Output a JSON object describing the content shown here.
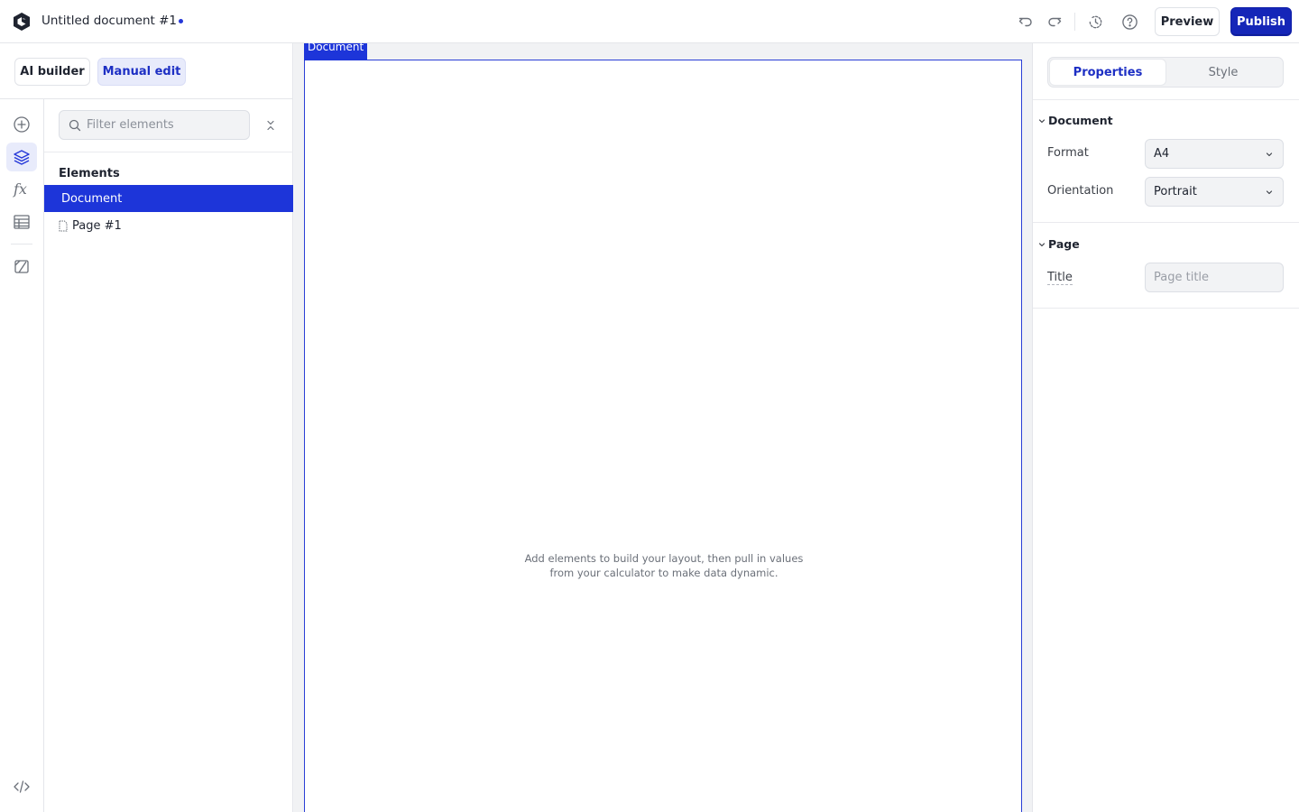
{
  "header": {
    "doc_title": "Untitled document #1",
    "unsaved_indicator": "unsaved-dot",
    "icons": [
      "logo-icon",
      "undo-icon",
      "redo-icon",
      "history-icon",
      "help-icon"
    ],
    "preview_label": "Preview",
    "publish_label": "Publish"
  },
  "modes": {
    "ai_builder_label": "AI builder",
    "manual_edit_label": "Manual edit",
    "active": "Manual edit"
  },
  "rail": {
    "items": [
      "add-icon",
      "layers-icon",
      "function-icon",
      "table-icon",
      "theme-icon"
    ],
    "active": "layers-icon",
    "bottom": "code-icon"
  },
  "elements_panel": {
    "filter_placeholder": "Filter elements",
    "filter_value": "",
    "heading": "Elements",
    "tree": [
      {
        "label": "Document",
        "selected": true
      },
      {
        "label": "Page #1",
        "selected": false
      }
    ]
  },
  "canvas": {
    "selection_tag": "Document",
    "hint_line1": "Add elements to build your layout, then pull in values",
    "hint_line2": "from your calculator to make data dynamic."
  },
  "right_panel": {
    "tabs": [
      {
        "label": "Properties",
        "active": true
      },
      {
        "label": "Style",
        "active": false
      }
    ],
    "document_section": {
      "title": "Document",
      "format_label": "Format",
      "format_value": "A4",
      "orientation_label": "Orientation",
      "orientation_value": "Portrait"
    },
    "page_section": {
      "title": "Page",
      "title_label": "Title",
      "title_placeholder": "Page title",
      "title_value": ""
    }
  },
  "colors": {
    "accent": "#1d35d9",
    "publish_bg": "#1526b8",
    "active_tint": "#e8ebfb",
    "canvas_bg": "#f1f2f4"
  }
}
